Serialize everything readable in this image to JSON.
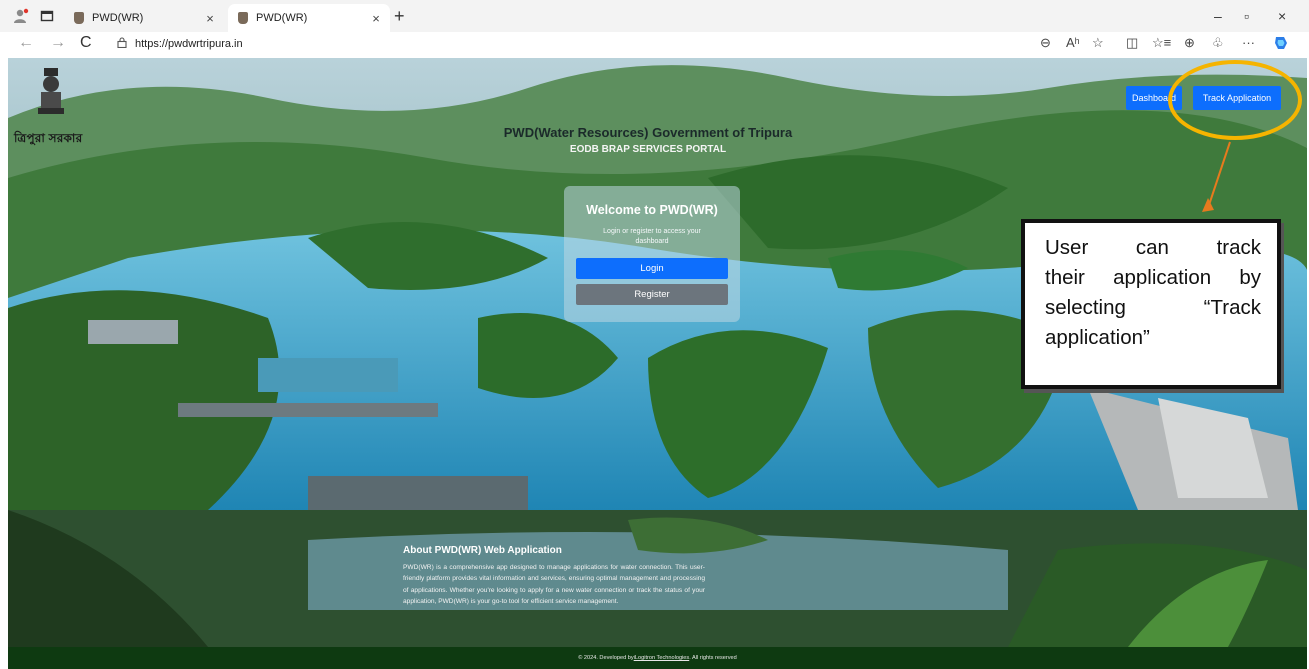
{
  "browser": {
    "tabs": [
      {
        "title": "PWD(WR)",
        "active": false
      },
      {
        "title": "PWD(WR)",
        "active": true
      }
    ],
    "tab_close": "×",
    "new_tab": "+",
    "window_controls": {
      "minimize": "–",
      "restore": "▫",
      "close": "×"
    },
    "url": "https://pwdwrtripura.in",
    "nav": {
      "back": "←",
      "forward": "→",
      "refresh": "C"
    },
    "toolbar_icons": [
      "zoom-icon",
      "read-aloud-icon",
      "favorite-star-icon",
      "split-screen-icon",
      "favorites-list-icon",
      "collections-icon",
      "extensions-icon",
      "more-icon",
      "copilot-icon"
    ],
    "toolbar_glyphs": {
      "zoom": "⊖",
      "read_aloud": "Aʰ",
      "favorite": "☆",
      "split": "◫",
      "favorites_list": "☆≡",
      "collections": "⊕",
      "extensions": "♧",
      "more": "···"
    }
  },
  "site": {
    "emblem_text": "ত্রিপুরা সরকার",
    "portal_title": "PWD(Water Resources) Government of Tripura",
    "portal_subtitle": "EODB BRAP SERVICES PORTAL",
    "nav": {
      "dashboard": "Dashboard",
      "track": "Track Application"
    },
    "welcome": {
      "title": "Welcome to PWD(WR)",
      "description": "Login or register to access your dashboard",
      "login": "Login",
      "register": "Register"
    },
    "about": {
      "title": "About PWD(WR) Web Application",
      "body": "PWD(WR) is a comprehensive app designed to manage applications for water connection. This user-friendly platform provides vital information and services, ensuring optimal management and processing of applications. Whether you're looking to apply for a new water connection or track the status of your application, PWD(WR) is your go-to tool for efficient service management."
    },
    "footer": {
      "prefix": "© 2024. Developed by ",
      "link": "iLogitron Technologies",
      "suffix": ". All rights reserved"
    }
  },
  "annotation": {
    "lines": [
      "User can track",
      "their application by",
      "selecting “Track",
      "application”"
    ],
    "highlight_color": "#f5b400",
    "arrow_color": "#e67a1e"
  },
  "colors": {
    "primary": "#0d6efd",
    "secondary": "#6c757d",
    "footer_bg": "#0e3a11"
  }
}
